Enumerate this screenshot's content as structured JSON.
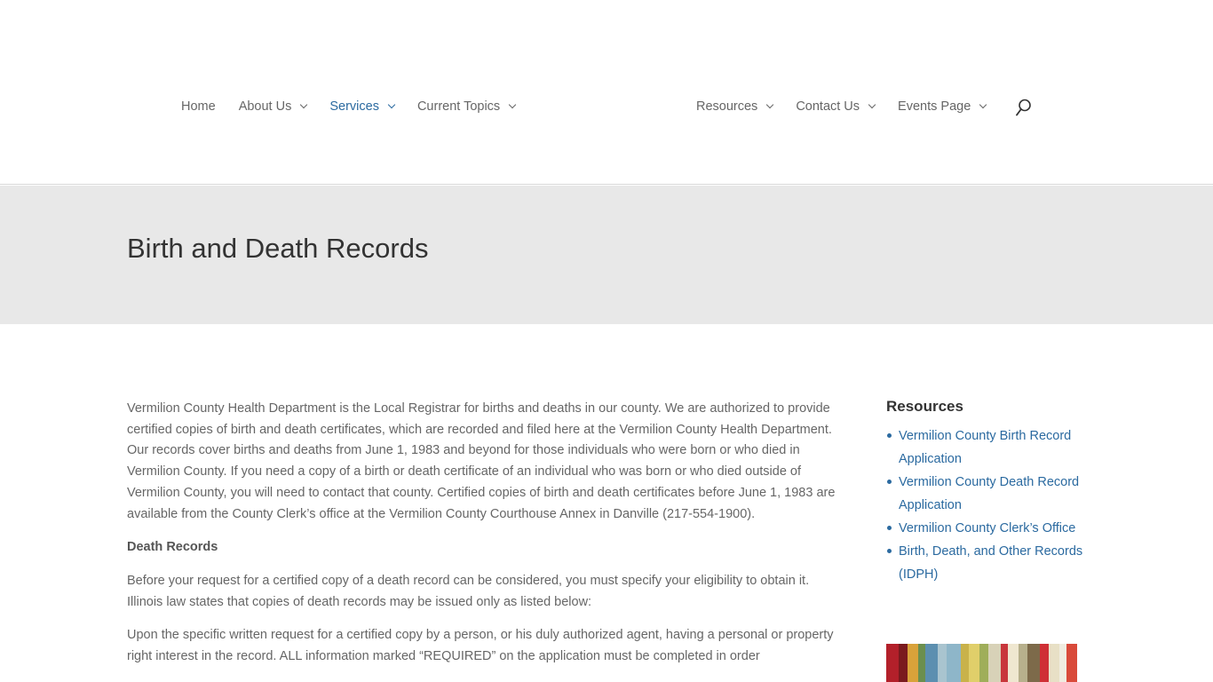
{
  "nav": {
    "left": [
      {
        "label": "Home",
        "dropdown": false,
        "active": false
      },
      {
        "label": "About Us",
        "dropdown": true,
        "active": false
      },
      {
        "label": "Services",
        "dropdown": true,
        "active": true
      },
      {
        "label": "Current Topics",
        "dropdown": true,
        "active": false
      }
    ],
    "right": [
      {
        "label": "Resources",
        "dropdown": true
      },
      {
        "label": "Contact Us",
        "dropdown": true
      },
      {
        "label": "Events Page",
        "dropdown": true
      }
    ],
    "search_icon": "search-icon"
  },
  "page": {
    "title": "Birth and Death Records"
  },
  "content": {
    "intro": "Vermilion County Health Department is the Local Registrar for births and deaths in our county. We are authorized to provide certified copies of birth and death certificates, which are recorded and filed here at the Vermilion County Health Department.  Our records cover births and deaths from June 1, 1983 and beyond for those individuals who were born or who died in Vermilion County.  If you need a copy of a birth or death certificate of an individual who was born or who died outside of Vermilion County, you will need to contact that county.  Certified copies of birth and death certificates before June 1, 1983 are available from the County Clerk’s office at the Vermilion County Courthouse Annex in Danville (217-554-1900).",
    "death_heading": "Death Records",
    "death_p1": "Before your request for a certified copy of a death record can be considered, you must specify your eligibility to obtain it. Illinois law states that copies of death records may be issued only as listed below:",
    "death_p2": "Upon the specific written request for a certified copy by a person, or his duly authorized agent, having a personal or property right interest in the record. ALL information marked “REQUIRED” on the application must be completed in order"
  },
  "sidebar": {
    "heading": "Resources",
    "links": [
      "Vermilion County Birth Record Application",
      "Vermilion County Death Record Application",
      "Vermilion County Clerk’s Office",
      "Birth, Death, and Other Records (IDPH)"
    ]
  },
  "colors": {
    "accent": "#2b6aa0",
    "title_band": "#e8e8e8",
    "body_text": "#666666"
  }
}
